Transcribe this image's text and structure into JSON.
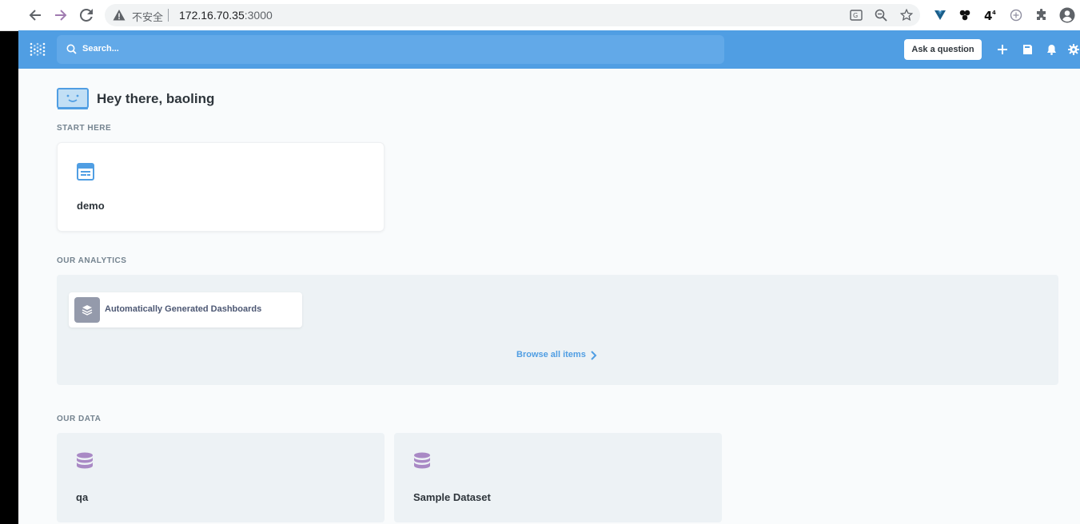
{
  "browser": {
    "security_label": "不安全",
    "url_host": "172.16.70.35",
    "url_port": ":3000"
  },
  "topbar": {
    "search_placeholder": "Search...",
    "ask_button": "Ask a question"
  },
  "greeting": "Hey there, baoling",
  "start_here": {
    "label": "START HERE",
    "items": [
      {
        "title": "demo"
      }
    ]
  },
  "analytics": {
    "label": "OUR ANALYTICS",
    "items": [
      {
        "title": "Automatically Generated Dashboards"
      }
    ],
    "browse_label": "Browse all items"
  },
  "our_data": {
    "label": "OUR DATA",
    "items": [
      {
        "title": "qa"
      },
      {
        "title": "Sample Dataset"
      }
    ]
  },
  "colors": {
    "brand": "#509ee3",
    "database_icon": "#a989c5",
    "text_dark": "#2e353b",
    "text_muted": "#74838f"
  }
}
